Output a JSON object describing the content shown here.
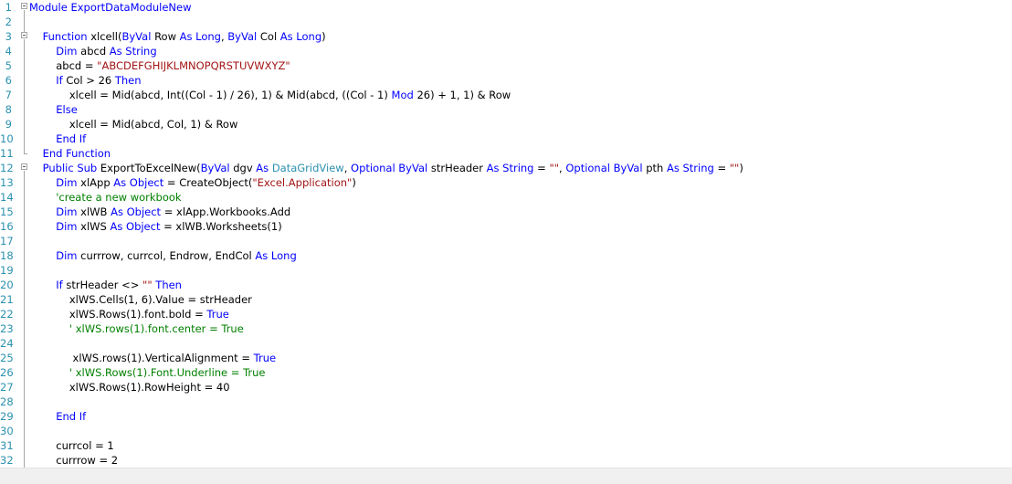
{
  "editor": {
    "lines": [
      {
        "n": "1",
        "fold": "box",
        "segments": [
          {
            "t": "Module ExportDataModuleNew",
            "c": "kw"
          }
        ]
      },
      {
        "n": "2",
        "segments": []
      },
      {
        "n": "3",
        "fold": "box",
        "segments": [
          {
            "t": "    ",
            "c": "pl"
          },
          {
            "t": "Function ",
            "c": "kw"
          },
          {
            "t": "xlcell(",
            "c": "pl"
          },
          {
            "t": "ByVal ",
            "c": "kw"
          },
          {
            "t": "Row ",
            "c": "pl"
          },
          {
            "t": "As Long",
            "c": "kw"
          },
          {
            "t": ", ",
            "c": "pl"
          },
          {
            "t": "ByVal ",
            "c": "kw"
          },
          {
            "t": "Col ",
            "c": "pl"
          },
          {
            "t": "As Long",
            "c": "kw"
          },
          {
            "t": ")",
            "c": "pl"
          }
        ]
      },
      {
        "n": "4",
        "segments": [
          {
            "t": "        ",
            "c": "pl"
          },
          {
            "t": "Dim ",
            "c": "kw"
          },
          {
            "t": "abcd ",
            "c": "pl"
          },
          {
            "t": "As String",
            "c": "kw"
          }
        ]
      },
      {
        "n": "5",
        "segments": [
          {
            "t": "        abcd = ",
            "c": "pl"
          },
          {
            "t": "\"ABCDEFGHIJKLMNOPQRSTUVWXYZ\"",
            "c": "st"
          }
        ]
      },
      {
        "n": "6",
        "segments": [
          {
            "t": "        ",
            "c": "pl"
          },
          {
            "t": "If ",
            "c": "kw"
          },
          {
            "t": "Col > 26 ",
            "c": "pl"
          },
          {
            "t": "Then",
            "c": "kw"
          }
        ]
      },
      {
        "n": "7",
        "segments": [
          {
            "t": "            xlcell = Mid(abcd, Int((Col - 1) / 26), 1) & Mid(abcd, ((Col - 1) ",
            "c": "pl"
          },
          {
            "t": "Mod ",
            "c": "kw"
          },
          {
            "t": "26) + 1, 1) & Row",
            "c": "pl"
          }
        ]
      },
      {
        "n": "8",
        "segments": [
          {
            "t": "        ",
            "c": "pl"
          },
          {
            "t": "Else",
            "c": "kw"
          }
        ]
      },
      {
        "n": "9",
        "segments": [
          {
            "t": "            xlcell = Mid(abcd, Col, 1) & Row",
            "c": "pl"
          }
        ]
      },
      {
        "n": "10",
        "segments": [
          {
            "t": "        ",
            "c": "pl"
          },
          {
            "t": "End If",
            "c": "kw"
          }
        ]
      },
      {
        "n": "11",
        "segments": [
          {
            "t": "    ",
            "c": "pl"
          },
          {
            "t": "End Function",
            "c": "kw"
          }
        ]
      },
      {
        "n": "12",
        "fold": "box",
        "segments": [
          {
            "t": "    ",
            "c": "pl"
          },
          {
            "t": "Public Sub ",
            "c": "kw"
          },
          {
            "t": "ExportToExcelNew(",
            "c": "pl"
          },
          {
            "t": "ByVal ",
            "c": "kw"
          },
          {
            "t": "dgv ",
            "c": "pl"
          },
          {
            "t": "As ",
            "c": "kw"
          },
          {
            "t": "DataGridView",
            "c": "ty"
          },
          {
            "t": ", ",
            "c": "pl"
          },
          {
            "t": "Optional ByVal ",
            "c": "kw"
          },
          {
            "t": "strHeader ",
            "c": "pl"
          },
          {
            "t": "As String ",
            "c": "kw"
          },
          {
            "t": "= ",
            "c": "pl"
          },
          {
            "t": "\"\"",
            "c": "st"
          },
          {
            "t": ", ",
            "c": "pl"
          },
          {
            "t": "Optional ByVal ",
            "c": "kw"
          },
          {
            "t": "pth ",
            "c": "pl"
          },
          {
            "t": "As String ",
            "c": "kw"
          },
          {
            "t": "= ",
            "c": "pl"
          },
          {
            "t": "\"\"",
            "c": "st"
          },
          {
            "t": ")",
            "c": "pl"
          }
        ]
      },
      {
        "n": "13",
        "segments": [
          {
            "t": "        ",
            "c": "pl"
          },
          {
            "t": "Dim ",
            "c": "kw"
          },
          {
            "t": "xlApp ",
            "c": "pl"
          },
          {
            "t": "As Object ",
            "c": "kw"
          },
          {
            "t": "= CreateObject(",
            "c": "pl"
          },
          {
            "t": "\"Excel.Application\"",
            "c": "st"
          },
          {
            "t": ")",
            "c": "pl"
          }
        ]
      },
      {
        "n": "14",
        "segments": [
          {
            "t": "        ",
            "c": "pl"
          },
          {
            "t": "'create a new workbook",
            "c": "cm"
          }
        ]
      },
      {
        "n": "15",
        "segments": [
          {
            "t": "        ",
            "c": "pl"
          },
          {
            "t": "Dim ",
            "c": "kw"
          },
          {
            "t": "xlWB ",
            "c": "pl"
          },
          {
            "t": "As Object ",
            "c": "kw"
          },
          {
            "t": "= xlApp.Workbooks.Add",
            "c": "pl"
          }
        ]
      },
      {
        "n": "16",
        "segments": [
          {
            "t": "        ",
            "c": "pl"
          },
          {
            "t": "Dim ",
            "c": "kw"
          },
          {
            "t": "xlWS ",
            "c": "pl"
          },
          {
            "t": "As Object ",
            "c": "kw"
          },
          {
            "t": "= xlWB.Worksheets(1)",
            "c": "pl"
          }
        ]
      },
      {
        "n": "17",
        "segments": []
      },
      {
        "n": "18",
        "segments": [
          {
            "t": "        ",
            "c": "pl"
          },
          {
            "t": "Dim ",
            "c": "kw"
          },
          {
            "t": "currrow, currcol, Endrow, EndCol ",
            "c": "pl"
          },
          {
            "t": "As Long",
            "c": "kw"
          }
        ]
      },
      {
        "n": "19",
        "segments": []
      },
      {
        "n": "20",
        "segments": [
          {
            "t": "        ",
            "c": "pl"
          },
          {
            "t": "If ",
            "c": "kw"
          },
          {
            "t": "strHeader <> ",
            "c": "pl"
          },
          {
            "t": "\"\" ",
            "c": "st"
          },
          {
            "t": "Then",
            "c": "kw"
          }
        ]
      },
      {
        "n": "21",
        "segments": [
          {
            "t": "            xlWS.Cells(1, 6).Value = strHeader",
            "c": "pl"
          }
        ]
      },
      {
        "n": "22",
        "segments": [
          {
            "t": "            xlWS.Rows(1).font.bold = ",
            "c": "pl"
          },
          {
            "t": "True",
            "c": "kw"
          }
        ]
      },
      {
        "n": "23",
        "segments": [
          {
            "t": "            ",
            "c": "pl"
          },
          {
            "t": "' xlWS.rows(1).font.center = True",
            "c": "cm"
          }
        ]
      },
      {
        "n": "24",
        "segments": []
      },
      {
        "n": "25",
        "segments": [
          {
            "t": "             xlWS.rows(1).VerticalAlignment = ",
            "c": "pl"
          },
          {
            "t": "True",
            "c": "kw"
          }
        ]
      },
      {
        "n": "26",
        "segments": [
          {
            "t": "            ",
            "c": "pl"
          },
          {
            "t": "' xlWS.Rows(1).Font.Underline = True",
            "c": "cm"
          }
        ]
      },
      {
        "n": "27",
        "segments": [
          {
            "t": "            xlWS.Rows(1).RowHeight = 40",
            "c": "pl"
          }
        ]
      },
      {
        "n": "28",
        "segments": []
      },
      {
        "n": "29",
        "segments": [
          {
            "t": "        ",
            "c": "pl"
          },
          {
            "t": "End If",
            "c": "kw"
          }
        ]
      },
      {
        "n": "30",
        "segments": []
      },
      {
        "n": "31",
        "segments": [
          {
            "t": "        currcol = 1",
            "c": "pl"
          }
        ]
      },
      {
        "n": "32",
        "segments": [
          {
            "t": "        currrow = 2",
            "c": "pl"
          }
        ]
      }
    ]
  }
}
